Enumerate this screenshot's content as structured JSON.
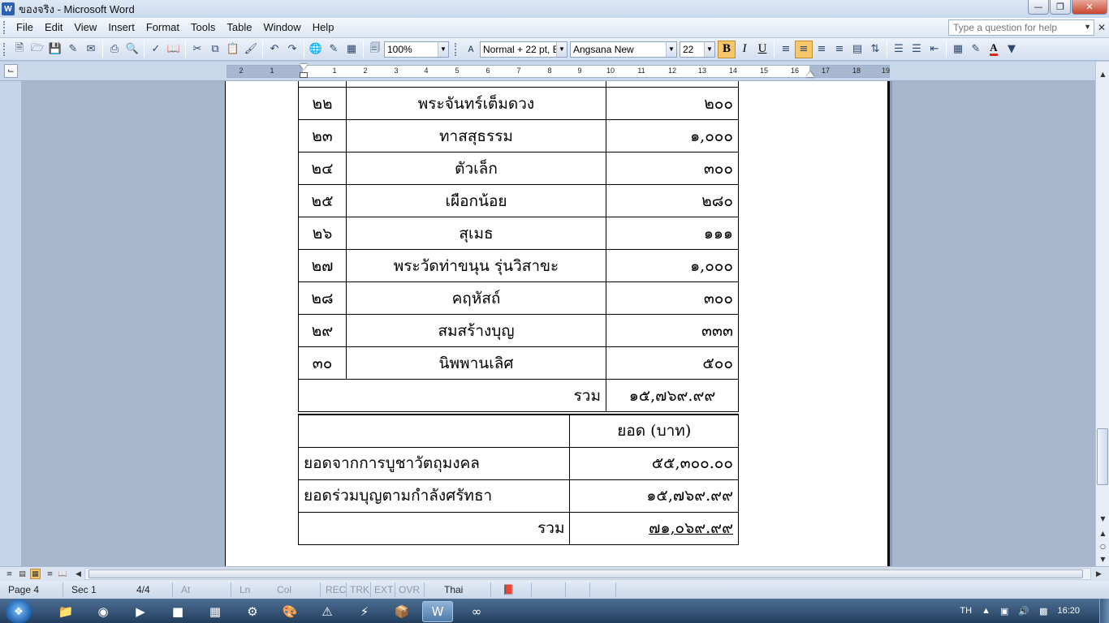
{
  "window": {
    "title": "ของจริง - Microsoft Word",
    "app_icon": "W",
    "buttons": [
      "minimize-icon",
      "restore-icon",
      "close-icon"
    ]
  },
  "menubar": {
    "items": [
      "File",
      "Edit",
      "View",
      "Insert",
      "Format",
      "Tools",
      "Table",
      "Window",
      "Help"
    ],
    "help_placeholder": "Type a question for help"
  },
  "toolbar": {
    "zoom": "100%",
    "style": "Normal + 22 pt, E",
    "font": "Angsana New",
    "font_size": "22",
    "font_color": "#e0281a",
    "highlight_active": "#f6c66b"
  },
  "ruler": {
    "left_numbers": [
      "2",
      "1"
    ],
    "right_numbers": [
      "1",
      "2",
      "3",
      "4",
      "5",
      "6",
      "7",
      "8",
      "9",
      "10",
      "11",
      "12",
      "13",
      "14",
      "15",
      "16",
      "17",
      "18",
      "19"
    ]
  },
  "document": {
    "donors": [
      {
        "no": "๒๒",
        "name": "พระจันทร์เต็มดวง",
        "amount": "๒๐๐"
      },
      {
        "no": "๒๓",
        "name": "ทาสสุธรรม",
        "amount": "๑,๐๐๐"
      },
      {
        "no": "๒๔",
        "name": "ตัวเล็ก",
        "amount": "๓๐๐"
      },
      {
        "no": "๒๕",
        "name": "เผือกน้อย",
        "amount": "๒๘๐"
      },
      {
        "no": "๒๖",
        "name": "สุเมธ",
        "amount": "๑๑๑"
      },
      {
        "no": "๒๗",
        "name": "พระวัดท่าขนุน รุ่นวิสาขะ",
        "amount": "๑,๐๐๐"
      },
      {
        "no": "๒๘",
        "name": "คฤหัสถ์",
        "amount": "๓๐๐"
      },
      {
        "no": "๒๙",
        "name": "สมสร้างบุญ",
        "amount": "๓๓๓"
      },
      {
        "no": "๓๐",
        "name": "นิพพานเลิศ",
        "amount": "๕๐๐"
      }
    ],
    "donor_total_label": "รวม",
    "donor_total_value": "๑๕,๗๖๙.๙๙",
    "summary_header": "ยอด (บาท)",
    "summary_rows": [
      {
        "label": "ยอดจากการบูชาวัตถุมงคล",
        "value": "๕๕,๓๐๐.๐๐"
      },
      {
        "label": "ยอดร่วมบุญตามกำลังศรัทธา",
        "value": "๑๕,๗๖๙.๙๙"
      }
    ],
    "summary_total_label": "รวม",
    "summary_total_value": "๗๑,๐๖๙.๙๙"
  },
  "statusbar": {
    "page": "Page 4",
    "sec": "Sec 1",
    "pages": "4/4",
    "at": "At",
    "ln": "Ln",
    "col": "Col",
    "rec": "REC",
    "trk": "TRK",
    "ext": "EXT",
    "ovr": "OVR",
    "language": "Thai"
  },
  "taskbar": {
    "tray_lang": "TH",
    "clock": "16:20",
    "apps": [
      "explorer-icon",
      "chrome-icon",
      "media-icon",
      "app-icon",
      "calculator-icon",
      "tool-icon",
      "paint-icon",
      "warning-app-icon",
      "flash-icon",
      "archive-icon",
      "word-icon",
      "remote-icon"
    ]
  }
}
